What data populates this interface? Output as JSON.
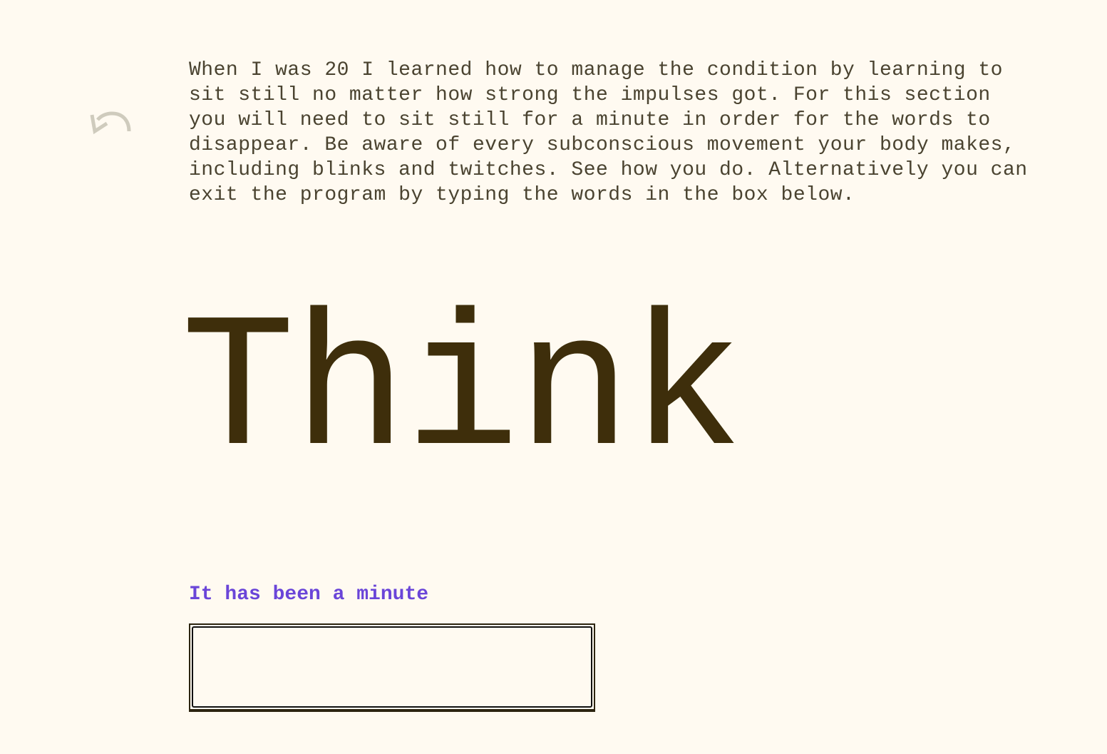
{
  "nav": {
    "back_icon": "undo-arrow-icon"
  },
  "intro": {
    "text": "When I was 20 I learned how to manage the condition by learning to sit still no matter how strong the impulses got. For this section you will need to sit still for a minute in order for the words to disappear. Be aware of every subconscious movement your body makes, including blinks and twitches. See how you do. Alternatively you can exit the program by typing the words in the box below."
  },
  "word": {
    "text": "Think"
  },
  "status": {
    "text": "It has been a minute",
    "color": "#6a45d8"
  },
  "input": {
    "value": "",
    "placeholder": ""
  },
  "colors": {
    "background": "#fffaf1",
    "intro_text": "#4a4330",
    "word": "#3e2e0b",
    "back_icon": "#cfcbbd"
  }
}
